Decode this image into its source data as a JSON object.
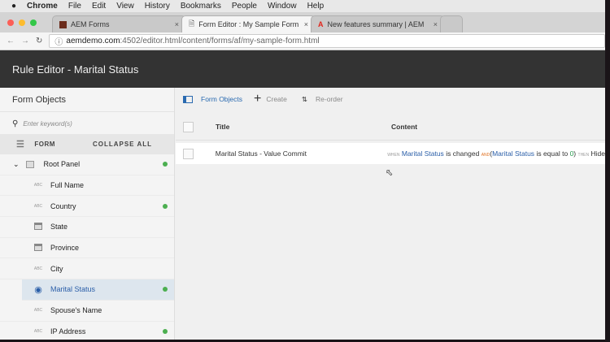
{
  "menubar": {
    "items": [
      "Chrome",
      "File",
      "Edit",
      "View",
      "History",
      "Bookmarks",
      "People",
      "Window",
      "Help"
    ]
  },
  "tabs": [
    {
      "title": "AEM Forms",
      "close": "×"
    },
    {
      "title": "Form Editor : My Sample Form",
      "close": "×"
    },
    {
      "title": "New features summary | AEM",
      "close": "×"
    }
  ],
  "address": {
    "host": "aemdemo.com",
    "rest": ":4502/editor.html/content/forms/af/my-sample-form.html"
  },
  "header": {
    "title": "Rule Editor - Marital Status"
  },
  "left": {
    "title": "Form Objects",
    "search_placeholder": "Enter keyword(s)",
    "form_label": "FORM",
    "collapse_all": "COLLAPSE ALL",
    "root": "Root Panel",
    "items": [
      {
        "label": "Full Name",
        "type": "ABC",
        "dot": false
      },
      {
        "label": "Country",
        "type": "ABC",
        "dot": true
      },
      {
        "label": "State",
        "type": "dropdown",
        "dot": false
      },
      {
        "label": "Province",
        "type": "dropdown",
        "dot": false
      },
      {
        "label": "City",
        "type": "ABC",
        "dot": false
      },
      {
        "label": "Marital Status",
        "type": "radio",
        "dot": true,
        "selected": true
      },
      {
        "label": "Spouse's Name",
        "type": "ABC",
        "dot": false
      },
      {
        "label": "IP Address",
        "type": "ABC",
        "dot": true
      }
    ]
  },
  "toolbar": {
    "form_objects": "Form Objects",
    "create": "Create",
    "reorder": "Re-order"
  },
  "table": {
    "headers": [
      "Title",
      "Content"
    ],
    "rows": [
      {
        "title": "Marital Status - Value Commit",
        "when": "WHEN",
        "field1": "Marital Status",
        "changed": "is changed",
        "and": "AND",
        "open": "(",
        "field2": "Marital Status",
        "equal": "is equal to",
        "value": "0",
        "close": ")",
        "then": "THEN",
        "action": "Hide"
      }
    ]
  },
  "colors": {
    "accent": "#2a6ab0",
    "dot": "#4caf50",
    "header": "#333333"
  }
}
